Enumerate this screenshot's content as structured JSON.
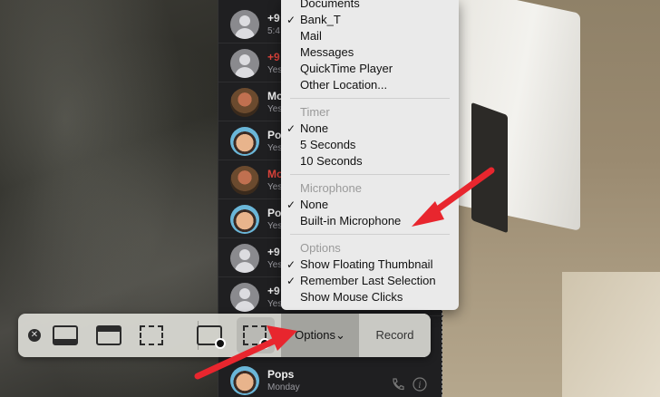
{
  "messages": [
    {
      "name": "+9",
      "sub": "5:4",
      "avatar": "generic",
      "red": false
    },
    {
      "name": "+9",
      "sub": "Yes",
      "avatar": "generic",
      "red": true
    },
    {
      "name": "Mo",
      "sub": "Yes",
      "avatar": "photo",
      "red": false
    },
    {
      "name": "Po",
      "sub": "Yes",
      "avatar": "cartoon",
      "red": false
    },
    {
      "name": "Mo",
      "sub": "Yes",
      "avatar": "photo",
      "red": true
    },
    {
      "name": "Pop",
      "sub": "Yes",
      "avatar": "cartoon",
      "red": false
    },
    {
      "name": "+9",
      "sub": "Yes",
      "avatar": "generic",
      "red": false
    },
    {
      "name": "+9",
      "sub": "Yesterday",
      "avatar": "generic",
      "red": false
    }
  ],
  "bottom_message": {
    "name": "Pops",
    "sub": "Monday"
  },
  "menu": {
    "save_items": [
      "Documents",
      "Bank_T",
      "Mail",
      "Messages",
      "QuickTime Player",
      "Other Location..."
    ],
    "save_checked": "Bank_T",
    "timer_header": "Timer",
    "timer_items": [
      "None",
      "5 Seconds",
      "10 Seconds"
    ],
    "timer_checked": "None",
    "mic_header": "Microphone",
    "mic_items": [
      "None",
      "Built-in Microphone"
    ],
    "mic_checked": "None",
    "options_header": "Options",
    "options_items": [
      "Show Floating Thumbnail",
      "Remember Last Selection",
      "Show Mouse Clicks"
    ],
    "options_checked": [
      "Show Floating Thumbnail",
      "Remember Last Selection"
    ]
  },
  "toolbar": {
    "options_label": "Options",
    "options_chevron": "⌄",
    "record_label": "Record",
    "close_glyph": "✕"
  },
  "icons": {
    "close": "close-icon",
    "capture_screen": "capture-entire-screen-icon",
    "capture_window": "capture-window-icon",
    "capture_selection": "capture-selection-icon",
    "record_screen": "record-entire-screen-icon",
    "record_selection": "record-selection-icon"
  },
  "colors": {
    "arrow": "#e8262e",
    "unread_name": "#e0443c"
  }
}
